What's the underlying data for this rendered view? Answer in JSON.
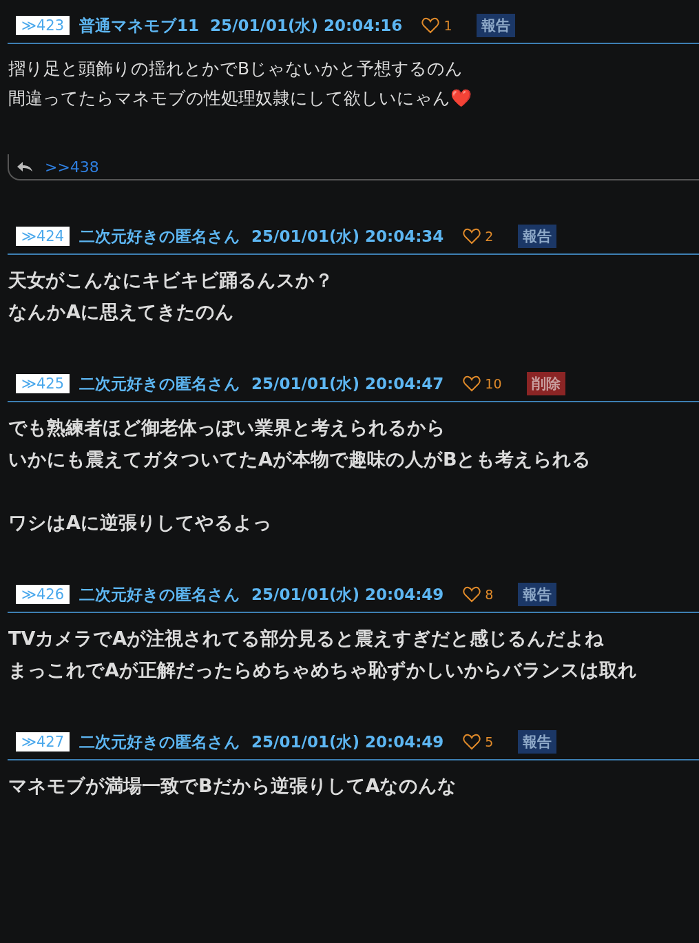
{
  "posts": [
    {
      "number": "≫423",
      "name": "普通マネモブ11",
      "date": "25/01/01(水) 20:04:16",
      "likes": "1",
      "action": {
        "kind": "report",
        "label": "報告"
      },
      "bold": false,
      "paragraphs": [
        [
          "摺り足と頭飾りの揺れとかでBじゃないかと予想するのん",
          "間違ってたらマネモブの性処理奴隷にして欲しいにゃん❤️"
        ]
      ],
      "replies": [
        ">>438"
      ]
    },
    {
      "number": "≫424",
      "name": "二次元好きの匿名さん",
      "date": "25/01/01(水) 20:04:34",
      "likes": "2",
      "action": {
        "kind": "report",
        "label": "報告"
      },
      "bold": true,
      "paragraphs": [
        [
          "天女がこんなにキビキビ踊るんスか？",
          "なんかAに思えてきたのん"
        ]
      ]
    },
    {
      "number": "≫425",
      "name": "二次元好きの匿名さん",
      "date": "25/01/01(水) 20:04:47",
      "likes": "10",
      "action": {
        "kind": "delete",
        "label": "削除"
      },
      "bold": true,
      "paragraphs": [
        [
          "でも熟練者ほど御老体っぽい業界と考えられるから",
          "いかにも震えてガタついてたAが本物で趣味の人がBとも考えられる"
        ],
        [
          "ワシはAに逆張りしてやるよっ"
        ]
      ]
    },
    {
      "number": "≫426",
      "name": "二次元好きの匿名さん",
      "date": "25/01/01(水) 20:04:49",
      "likes": "8",
      "action": {
        "kind": "report",
        "label": "報告"
      },
      "bold": true,
      "paragraphs": [
        [
          "TVカメラでAが注視されてる部分見ると震えすぎだと感じるんだよね",
          "まっこれでAが正解だったらめちゃめちゃ恥ずかしいからバランスは取れ"
        ]
      ]
    },
    {
      "number": "≫427",
      "name": "二次元好きの匿名さん",
      "date": "25/01/01(水) 20:04:49",
      "likes": "5",
      "action": {
        "kind": "report",
        "label": "報告"
      },
      "bold": true,
      "paragraphs": [
        [
          "マネモブが満場一致でBだから逆張りしてAなのんな"
        ]
      ]
    }
  ]
}
